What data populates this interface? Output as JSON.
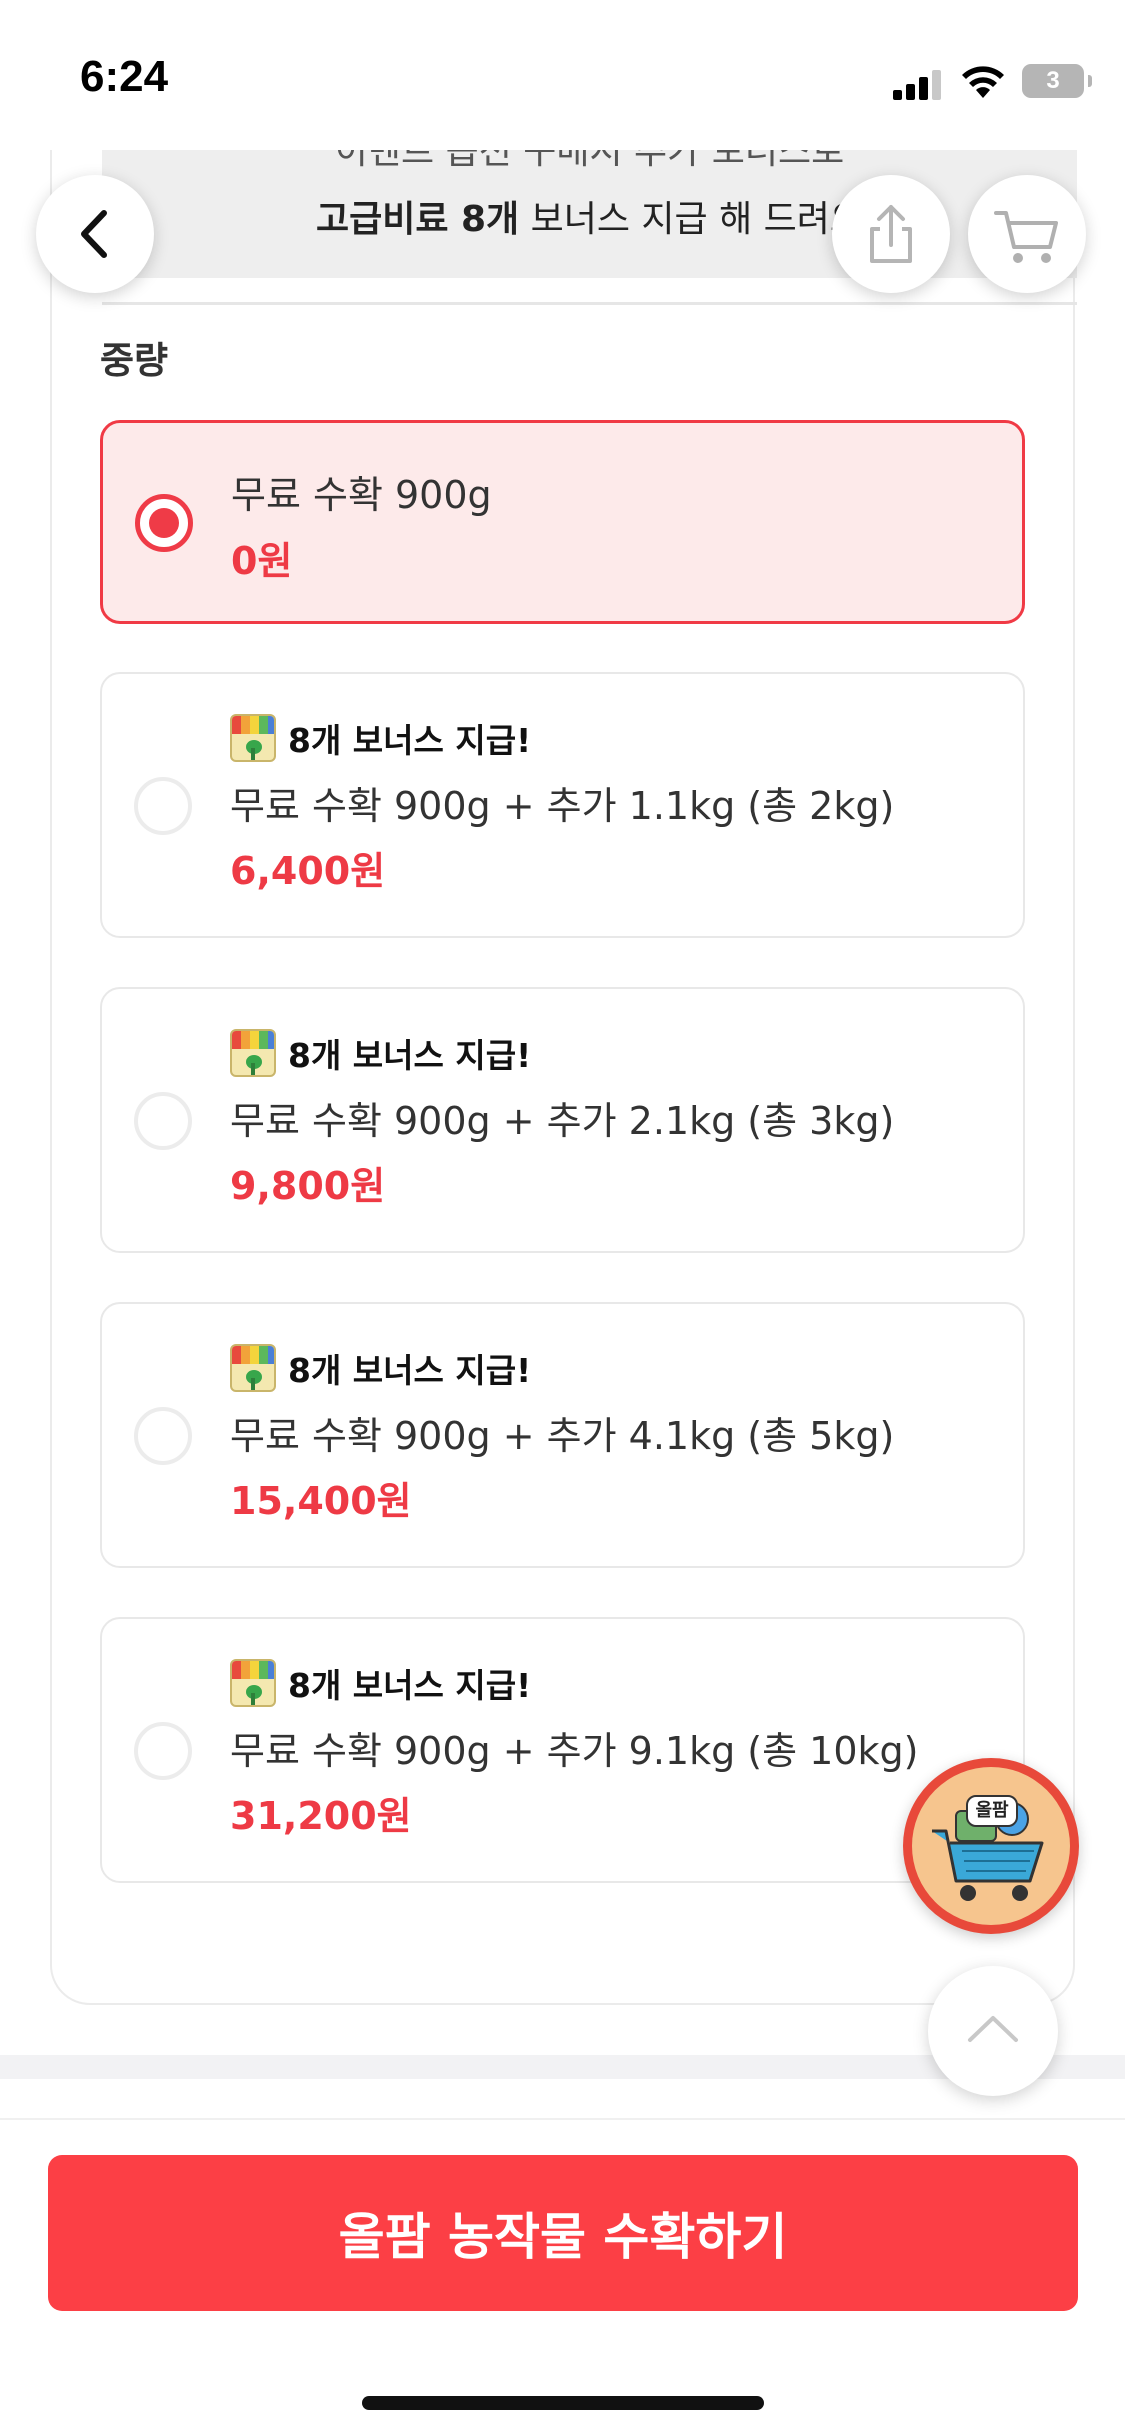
{
  "status_bar": {
    "time": "6:24",
    "battery": "3"
  },
  "event_banner": {
    "line1": "이벤트 옵션 구매시 추가 보너스로",
    "line2_bold": "고급비료 8개",
    "line2_rest": " 보너스 지급 해 드려요"
  },
  "section_label": "중량",
  "options": [
    {
      "desc": "무료 수확 900g",
      "price": "0원",
      "selected": true
    },
    {
      "bonus": "8개 보너스 지급!",
      "desc": "무료 수확 900g + 추가 1.1kg (총 2kg)",
      "price": "6,400원",
      "selected": false
    },
    {
      "bonus": "8개 보너스 지급!",
      "desc": "무료 수확 900g + 추가 2.1kg (총 3kg)",
      "price": "9,800원",
      "selected": false
    },
    {
      "bonus": "8개 보너스 지급!",
      "desc": "무료 수확 900g + 추가 4.1kg (총 5kg)",
      "price": "15,400원",
      "selected": false
    },
    {
      "bonus": "8개 보너스 지급!",
      "desc": "무료 수확 900g + 추가 9.1kg (총 10kg)",
      "price": "31,200원",
      "selected": false
    }
  ],
  "floating_cart_badge": "올팜",
  "cta_label": "올팜 농작물 수확하기",
  "colors": {
    "accent": "#fc3f45",
    "price": "#ee3a45",
    "selected_bg": "#fdeaea"
  },
  "icons": [
    "back-icon",
    "share-icon",
    "cart-icon",
    "scroll-top-icon",
    "fertilizer-bag-icon"
  ]
}
